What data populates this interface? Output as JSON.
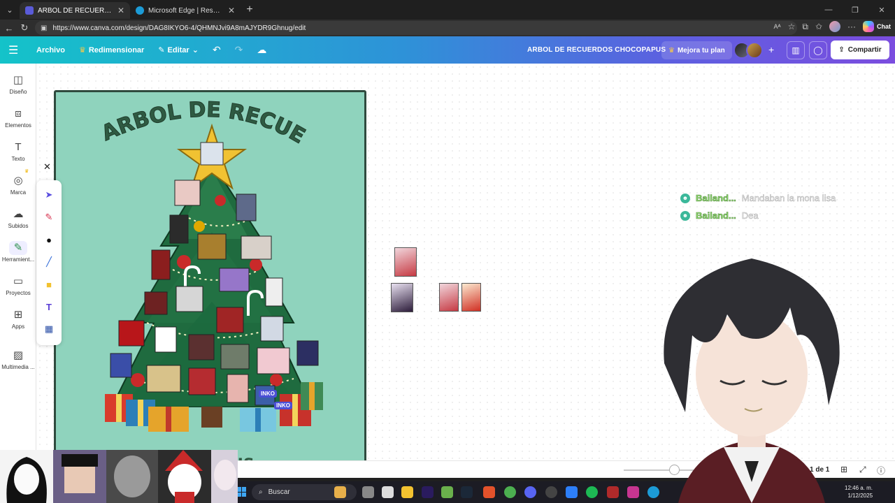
{
  "browser": {
    "tabs": [
      {
        "title": "ARBOL DE RECUERDOS CHOCOPAPUS",
        "active": true,
        "color": "#5a5bd8"
      },
      {
        "title": "Microsoft Edge | Resumen del año",
        "active": false,
        "color": "#1c9bd6"
      }
    ],
    "url": "https://www.canva.com/design/DAG8IKYO6-4/QHMNJvi9A8mAJYDR9Ghnug/edit",
    "chat_label": "Chat"
  },
  "header": {
    "archivo": "Archivo",
    "redimensionar": "Redimensionar",
    "editar": "Editar",
    "title": "ARBOL DE RECUERDOS CHOCOPAPUS",
    "plan": "Mejora tu plan",
    "share": "Compartir"
  },
  "rail": [
    {
      "label": "Diseño",
      "icon": "layout-icon"
    },
    {
      "label": "Elementos",
      "icon": "shapes-icon"
    },
    {
      "label": "Texto",
      "icon": "text-icon"
    },
    {
      "label": "Marca",
      "icon": "brand-icon"
    },
    {
      "label": "Subidos",
      "icon": "cloud-upload-icon"
    },
    {
      "label": "Herramient...",
      "icon": "pen-tools-icon"
    },
    {
      "label": "Proyectos",
      "icon": "folder-icon"
    },
    {
      "label": "Apps",
      "icon": "apps-icon"
    },
    {
      "label": "Multimedia ...",
      "icon": "image-icon"
    }
  ],
  "poster": {
    "title": "ARBOL DE RECUERDOS",
    "bottom_text": "US",
    "background": "#8fd3bd",
    "cursor_tags": [
      "INKO",
      "INKO"
    ]
  },
  "chat": [
    {
      "user": "Bailand...",
      "message": "Mandaban la mona lisa"
    },
    {
      "user": "Bailand...",
      "message": "Dea"
    }
  ],
  "zoom": {
    "level": 0.55,
    "pages": "1 de 1"
  },
  "taskbar": {
    "search_placeholder": "Buscar",
    "time": "12:46 a. m.",
    "date": "1/12/2025"
  }
}
